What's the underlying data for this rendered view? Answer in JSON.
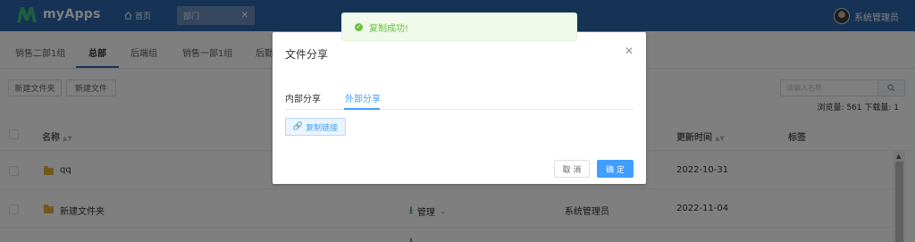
{
  "app": {
    "name": "myApps"
  },
  "header": {
    "home_label": "首页",
    "active_tab_label": "部门",
    "user_name": "系统管理员"
  },
  "group_tabs": [
    "销售二部1组",
    "总部",
    "后端组",
    "销售一部1组",
    "后勤"
  ],
  "toolbar": {
    "new_folder_label": "新建文件夹",
    "new_file_label": "新建文件",
    "search_placeholder": "请输入名称",
    "stats": "浏览量: 561 下载量: 1"
  },
  "table": {
    "columns": [
      "名称",
      "更新时间",
      "标签"
    ],
    "rows": [
      {
        "name": "qq",
        "updater": "",
        "updated": "2022-10-31"
      },
      {
        "name": "新建文件夹",
        "action": "管理",
        "updater": "系统管理员",
        "updated": "2022-11-04"
      }
    ]
  },
  "dialog": {
    "title": "文件分享",
    "tabs": [
      "内部分享",
      "外部分享"
    ],
    "copy_link_label": "复制链接",
    "cancel_label": "取 消",
    "ok_label": "确 定"
  },
  "toast": {
    "message": "复制成功!"
  },
  "colors": {
    "primary": "#409eff",
    "header": "#2d66ad",
    "success": "#67c23a"
  }
}
